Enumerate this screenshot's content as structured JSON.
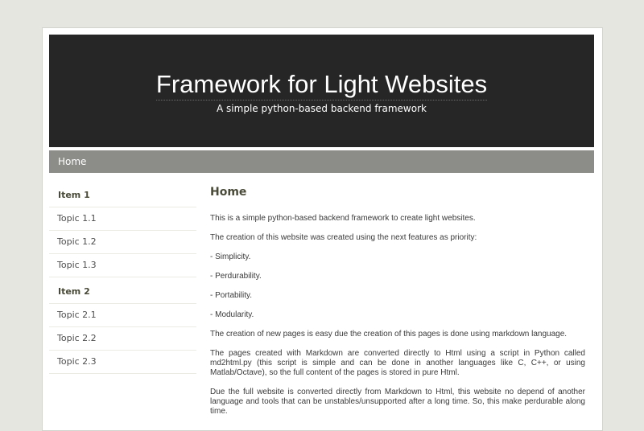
{
  "header": {
    "title": "Framework for Light Websites",
    "subtitle": "A simple python-based backend framework"
  },
  "nav": {
    "items": [
      {
        "label": "Home"
      }
    ]
  },
  "sidebar": {
    "groups": [
      {
        "heading": "Item 1",
        "links": [
          "Topic 1.1",
          "Topic 1.2",
          "Topic 1.3"
        ]
      },
      {
        "heading": "Item 2",
        "links": [
          "Topic 2.1",
          "Topic 2.2",
          "Topic 2.3"
        ]
      }
    ]
  },
  "main": {
    "title": "Home",
    "paragraphs": [
      "This is a simple python-based backend framework to create light websites.",
      "The creation of this website was created using the next features as priority:",
      "- Simplicity.",
      "- Perdurability.",
      "- Portability.",
      "- Modularity.",
      "The creation of new pages is easy due the creation of this pages is done using markdown language.",
      "The pages created with Markdown are converted directly to Html using a script in Python called md2html.py (this script is simple and can be done in another languages like C, C++, or using Matlab/Octave), so the full content of the pages is stored in pure Html.",
      "Due the full website is converted directly from Markdown to Html, this website no depend of another language and tools that can be unstables/unsupported after a long time. So, this make perdurable along time."
    ]
  },
  "colors": {
    "page_background": "#e6e6e1",
    "header_background": "#262626",
    "navbar_background": "#8c8c88",
    "heading_text": "#4a4a38"
  }
}
